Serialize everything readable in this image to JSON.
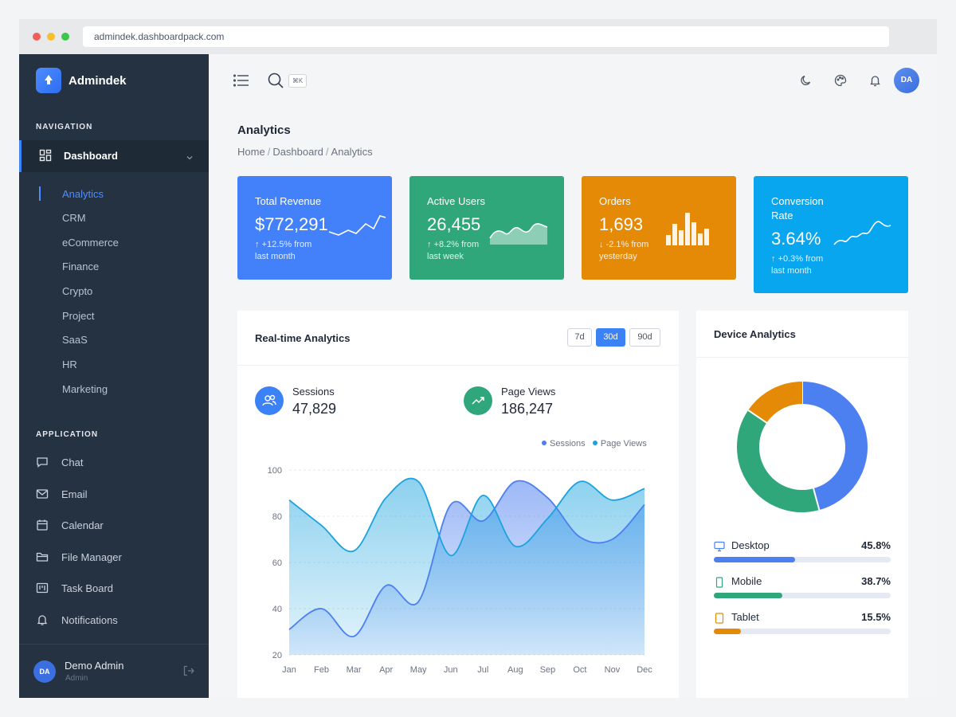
{
  "browser": {
    "url": "admindek.dashboardpack.com"
  },
  "sidebar": {
    "brand": "Admindek",
    "nav_title": "NAVIGATION",
    "dashboard_label": "Dashboard",
    "dashboard_items": [
      {
        "label": "Analytics",
        "active": true
      },
      {
        "label": "CRM"
      },
      {
        "label": "eCommerce"
      },
      {
        "label": "Finance"
      },
      {
        "label": "Crypto"
      },
      {
        "label": "Project"
      },
      {
        "label": "SaaS"
      },
      {
        "label": "HR"
      },
      {
        "label": "Marketing"
      }
    ],
    "app_title": "APPLICATION",
    "app_items": [
      {
        "label": "Chat",
        "icon": "chat-icon"
      },
      {
        "label": "Email",
        "icon": "mail-icon"
      },
      {
        "label": "Calendar",
        "icon": "calendar-icon"
      },
      {
        "label": "File Manager",
        "icon": "folder-icon"
      },
      {
        "label": "Task Board",
        "icon": "kanban-icon"
      },
      {
        "label": "Notifications",
        "icon": "bell-icon"
      }
    ],
    "user": {
      "initials": "DA",
      "name": "Demo Admin",
      "role": "Admin"
    }
  },
  "topbar": {
    "shortcut": "⌘K",
    "avatar_initials": "DA"
  },
  "page": {
    "title": "Analytics",
    "breadcrumb": [
      "Home",
      "Dashboard",
      "Analytics"
    ]
  },
  "stats": [
    {
      "title": "Total Revenue",
      "value": "$772,291",
      "delta": "↑ +12.5% from",
      "period": "last month",
      "color": "#4381fb"
    },
    {
      "title": "Active Users",
      "value": "26,455",
      "delta": "↑ +8.2% from",
      "period": "last week",
      "color": "#2fa77a"
    },
    {
      "title": "Orders",
      "value": "1,693",
      "delta": "↓ -2.1% from",
      "period": "yesterday",
      "color": "#e58a07"
    },
    {
      "title_line1": "Conversion",
      "title_line2": "Rate",
      "value": "3.64%",
      "delta": "↑ +0.3% from",
      "period": "last month",
      "color": "#08a6ef"
    }
  ],
  "realtime": {
    "title": "Real-time Analytics",
    "ranges": [
      "7d",
      "30d",
      "90d"
    ],
    "selected_range": "30d",
    "sessions_label": "Sessions",
    "sessions_value": "47,829",
    "pageviews_label": "Page Views",
    "pageviews_value": "186,247"
  },
  "chart_data": {
    "type": "area",
    "x": [
      "Jan",
      "Feb",
      "Mar",
      "Apr",
      "May",
      "Jun",
      "Jul",
      "Aug",
      "Sep",
      "Oct",
      "Nov",
      "Dec"
    ],
    "series": [
      {
        "name": "Sessions",
        "color": "#4c7ff0",
        "values": [
          31,
          40,
          28,
          50,
          43,
          85,
          78,
          95,
          88,
          71,
          70,
          85
        ]
      },
      {
        "name": "Page Views",
        "color": "#1aa3df",
        "values": [
          87,
          76,
          65,
          88,
          95,
          63,
          89,
          67,
          79,
          95,
          87,
          92
        ]
      }
    ],
    "ylim": [
      20,
      100
    ],
    "yticks": [
      20,
      40,
      60,
      80,
      100
    ],
    "grid": true,
    "legend": "top-right"
  },
  "devices": {
    "title": "Device Analytics",
    "items": [
      {
        "label": "Desktop",
        "percent": "45.8%",
        "value": 45.8,
        "color": "#4c7ff0",
        "icon": "monitor-icon"
      },
      {
        "label": "Mobile",
        "percent": "38.7%",
        "value": 38.7,
        "color": "#2fa77a",
        "icon": "phone-icon"
      },
      {
        "label": "Tablet",
        "percent": "15.5%",
        "value": 15.5,
        "color": "#e58a07",
        "icon": "tablet-icon"
      }
    ]
  }
}
